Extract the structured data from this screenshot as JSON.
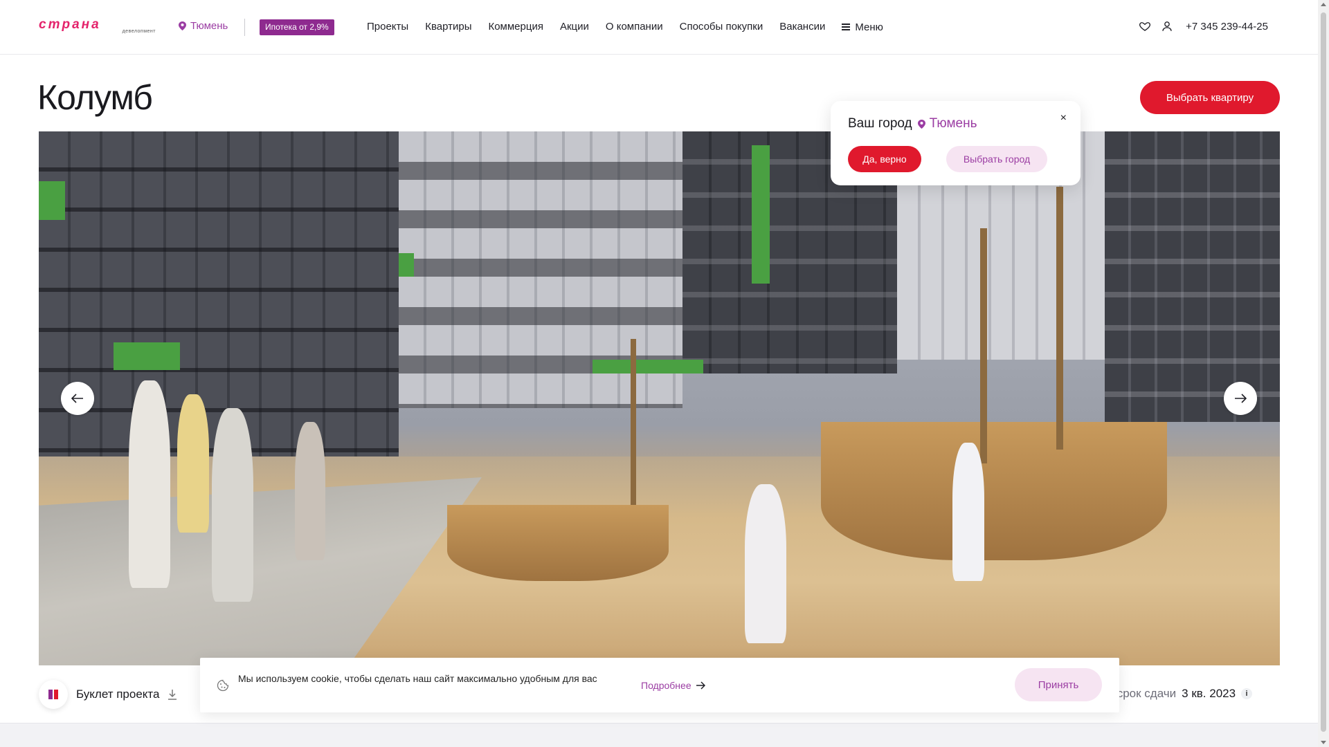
{
  "header": {
    "logo_text": "страна",
    "logo_sub": "девелопмент",
    "city": "Тюмень",
    "promo": "Ипотека от 2,9%",
    "nav": [
      "Проекты",
      "Квартиры",
      "Коммерция",
      "Акции",
      "О компании",
      "Способы покупки",
      "Вакансии"
    ],
    "menu_label": "Меню",
    "phone": "+7 345 239-44-25"
  },
  "main": {
    "title": "Колумб",
    "choose_button": "Выбрать квартиру",
    "booklet_label": "Буклет проекта",
    "deadline_label": "ий срок сдачи",
    "deadline_value": "3 кв. 2023",
    "info_icon": "i"
  },
  "city_popup": {
    "question": "Ваш город",
    "city": "Тюмень",
    "close": "×",
    "confirm": "Да, верно",
    "choose_other": "Выбрать город"
  },
  "cookie": {
    "text": "Мы используем cookie, чтобы сделать наш сайт максимально удобным для вас",
    "more": "Подробнее",
    "accept": "Принять"
  },
  "colors": {
    "accent_red": "#e0192d",
    "brand_purple": "#9b3da3",
    "brand_pink": "#e4236b",
    "light_pink": "#f6e4f2"
  }
}
